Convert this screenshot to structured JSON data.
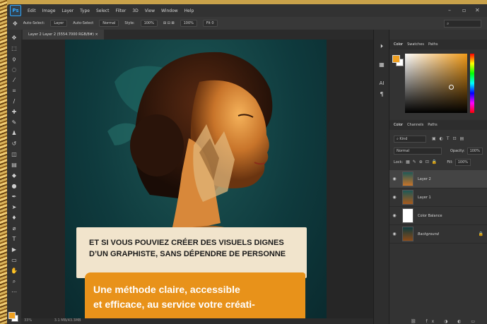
{
  "menubar": {
    "app_icon": "Ps",
    "items": [
      "Edit",
      "Image",
      "Layer",
      "Type",
      "Select",
      "Filter",
      "3D",
      "View",
      "Window",
      "Help"
    ]
  },
  "options": {
    "auto_select_label": "Auto-Select:",
    "auto_select_value": "Layer",
    "transform_controls": "Auto-Select",
    "mode": "Normal",
    "style_label": "Style:",
    "style_value": "100%",
    "percent_value": "100%",
    "mode2": "Fit 0",
    "search_icon": "search-icon"
  },
  "document": {
    "tab_label": "Layer 2  Layer 2 (5554.7000 RGB/8#)  ×"
  },
  "status": {
    "zoom": "33%",
    "info": "3.1 MB/43.3MB"
  },
  "color_panel": {
    "tabs": [
      "Color",
      "Swatches",
      "Paths"
    ],
    "fg": "#f0a020",
    "bg": "#ffffff"
  },
  "layers_panel": {
    "tabs": [
      "Color",
      "Channels",
      "Paths"
    ],
    "filter_kind": "Kind",
    "blend_mode": "Normal",
    "opacity_label": "Opacity:",
    "opacity_value": "100%",
    "lock_label": "Lock:",
    "fill_label": "Fill:",
    "fill_value": "100%",
    "layers": [
      {
        "name": "Layer 2",
        "active": true
      },
      {
        "name": "Layer 1",
        "active": false
      },
      {
        "name": "Color Balance",
        "active": false
      },
      {
        "name": "Background",
        "active": false
      }
    ]
  },
  "artwork": {
    "headline_line1": "ET SI VOUS POUVIEZ CRÉER DES VISUELS DIGNES",
    "headline_line2": "D’UN GRAPHISTE, SANS DÉPENDRE DE PERSONNE",
    "sub_line1": "Une méthode claire, accessible",
    "sub_line2": "et efficace, au service votre créati-"
  },
  "side_strip": {
    "label1": "AI"
  }
}
